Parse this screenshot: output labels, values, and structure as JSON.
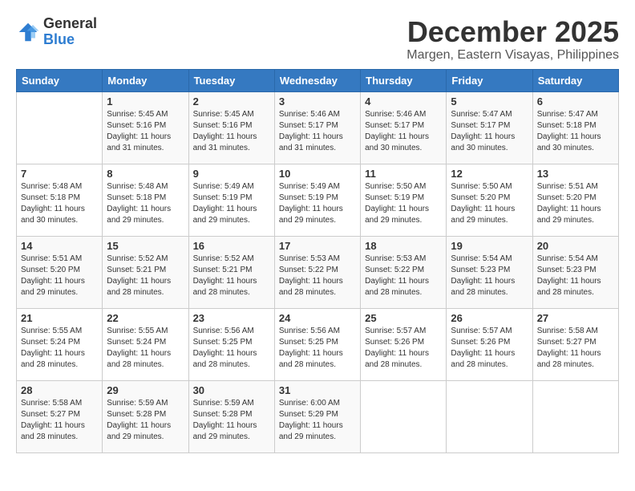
{
  "header": {
    "logo_general": "General",
    "logo_blue": "Blue",
    "month_title": "December 2025",
    "location": "Margen, Eastern Visayas, Philippines"
  },
  "days_of_week": [
    "Sunday",
    "Monday",
    "Tuesday",
    "Wednesday",
    "Thursday",
    "Friday",
    "Saturday"
  ],
  "weeks": [
    [
      {
        "day": "",
        "sunrise": "",
        "sunset": "",
        "daylight": ""
      },
      {
        "day": "1",
        "sunrise": "Sunrise: 5:45 AM",
        "sunset": "Sunset: 5:16 PM",
        "daylight": "Daylight: 11 hours and 31 minutes."
      },
      {
        "day": "2",
        "sunrise": "Sunrise: 5:45 AM",
        "sunset": "Sunset: 5:16 PM",
        "daylight": "Daylight: 11 hours and 31 minutes."
      },
      {
        "day": "3",
        "sunrise": "Sunrise: 5:46 AM",
        "sunset": "Sunset: 5:17 PM",
        "daylight": "Daylight: 11 hours and 31 minutes."
      },
      {
        "day": "4",
        "sunrise": "Sunrise: 5:46 AM",
        "sunset": "Sunset: 5:17 PM",
        "daylight": "Daylight: 11 hours and 30 minutes."
      },
      {
        "day": "5",
        "sunrise": "Sunrise: 5:47 AM",
        "sunset": "Sunset: 5:17 PM",
        "daylight": "Daylight: 11 hours and 30 minutes."
      },
      {
        "day": "6",
        "sunrise": "Sunrise: 5:47 AM",
        "sunset": "Sunset: 5:18 PM",
        "daylight": "Daylight: 11 hours and 30 minutes."
      }
    ],
    [
      {
        "day": "7",
        "sunrise": "Sunrise: 5:48 AM",
        "sunset": "Sunset: 5:18 PM",
        "daylight": "Daylight: 11 hours and 30 minutes."
      },
      {
        "day": "8",
        "sunrise": "Sunrise: 5:48 AM",
        "sunset": "Sunset: 5:18 PM",
        "daylight": "Daylight: 11 hours and 29 minutes."
      },
      {
        "day": "9",
        "sunrise": "Sunrise: 5:49 AM",
        "sunset": "Sunset: 5:19 PM",
        "daylight": "Daylight: 11 hours and 29 minutes."
      },
      {
        "day": "10",
        "sunrise": "Sunrise: 5:49 AM",
        "sunset": "Sunset: 5:19 PM",
        "daylight": "Daylight: 11 hours and 29 minutes."
      },
      {
        "day": "11",
        "sunrise": "Sunrise: 5:50 AM",
        "sunset": "Sunset: 5:19 PM",
        "daylight": "Daylight: 11 hours and 29 minutes."
      },
      {
        "day": "12",
        "sunrise": "Sunrise: 5:50 AM",
        "sunset": "Sunset: 5:20 PM",
        "daylight": "Daylight: 11 hours and 29 minutes."
      },
      {
        "day": "13",
        "sunrise": "Sunrise: 5:51 AM",
        "sunset": "Sunset: 5:20 PM",
        "daylight": "Daylight: 11 hours and 29 minutes."
      }
    ],
    [
      {
        "day": "14",
        "sunrise": "Sunrise: 5:51 AM",
        "sunset": "Sunset: 5:20 PM",
        "daylight": "Daylight: 11 hours and 29 minutes."
      },
      {
        "day": "15",
        "sunrise": "Sunrise: 5:52 AM",
        "sunset": "Sunset: 5:21 PM",
        "daylight": "Daylight: 11 hours and 28 minutes."
      },
      {
        "day": "16",
        "sunrise": "Sunrise: 5:52 AM",
        "sunset": "Sunset: 5:21 PM",
        "daylight": "Daylight: 11 hours and 28 minutes."
      },
      {
        "day": "17",
        "sunrise": "Sunrise: 5:53 AM",
        "sunset": "Sunset: 5:22 PM",
        "daylight": "Daylight: 11 hours and 28 minutes."
      },
      {
        "day": "18",
        "sunrise": "Sunrise: 5:53 AM",
        "sunset": "Sunset: 5:22 PM",
        "daylight": "Daylight: 11 hours and 28 minutes."
      },
      {
        "day": "19",
        "sunrise": "Sunrise: 5:54 AM",
        "sunset": "Sunset: 5:23 PM",
        "daylight": "Daylight: 11 hours and 28 minutes."
      },
      {
        "day": "20",
        "sunrise": "Sunrise: 5:54 AM",
        "sunset": "Sunset: 5:23 PM",
        "daylight": "Daylight: 11 hours and 28 minutes."
      }
    ],
    [
      {
        "day": "21",
        "sunrise": "Sunrise: 5:55 AM",
        "sunset": "Sunset: 5:24 PM",
        "daylight": "Daylight: 11 hours and 28 minutes."
      },
      {
        "day": "22",
        "sunrise": "Sunrise: 5:55 AM",
        "sunset": "Sunset: 5:24 PM",
        "daylight": "Daylight: 11 hours and 28 minutes."
      },
      {
        "day": "23",
        "sunrise": "Sunrise: 5:56 AM",
        "sunset": "Sunset: 5:25 PM",
        "daylight": "Daylight: 11 hours and 28 minutes."
      },
      {
        "day": "24",
        "sunrise": "Sunrise: 5:56 AM",
        "sunset": "Sunset: 5:25 PM",
        "daylight": "Daylight: 11 hours and 28 minutes."
      },
      {
        "day": "25",
        "sunrise": "Sunrise: 5:57 AM",
        "sunset": "Sunset: 5:26 PM",
        "daylight": "Daylight: 11 hours and 28 minutes."
      },
      {
        "day": "26",
        "sunrise": "Sunrise: 5:57 AM",
        "sunset": "Sunset: 5:26 PM",
        "daylight": "Daylight: 11 hours and 28 minutes."
      },
      {
        "day": "27",
        "sunrise": "Sunrise: 5:58 AM",
        "sunset": "Sunset: 5:27 PM",
        "daylight": "Daylight: 11 hours and 28 minutes."
      }
    ],
    [
      {
        "day": "28",
        "sunrise": "Sunrise: 5:58 AM",
        "sunset": "Sunset: 5:27 PM",
        "daylight": "Daylight: 11 hours and 28 minutes."
      },
      {
        "day": "29",
        "sunrise": "Sunrise: 5:59 AM",
        "sunset": "Sunset: 5:28 PM",
        "daylight": "Daylight: 11 hours and 29 minutes."
      },
      {
        "day": "30",
        "sunrise": "Sunrise: 5:59 AM",
        "sunset": "Sunset: 5:28 PM",
        "daylight": "Daylight: 11 hours and 29 minutes."
      },
      {
        "day": "31",
        "sunrise": "Sunrise: 6:00 AM",
        "sunset": "Sunset: 5:29 PM",
        "daylight": "Daylight: 11 hours and 29 minutes."
      },
      {
        "day": "",
        "sunrise": "",
        "sunset": "",
        "daylight": ""
      },
      {
        "day": "",
        "sunrise": "",
        "sunset": "",
        "daylight": ""
      },
      {
        "day": "",
        "sunrise": "",
        "sunset": "",
        "daylight": ""
      }
    ]
  ]
}
